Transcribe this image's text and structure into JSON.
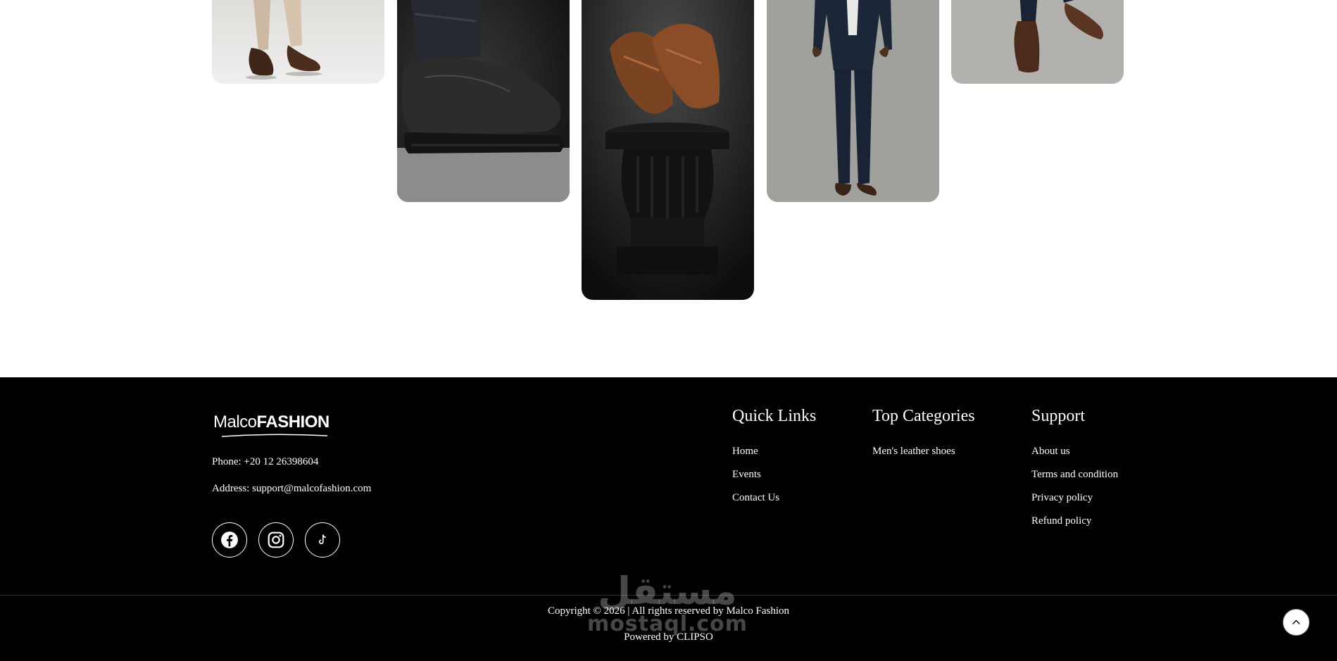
{
  "gallery": {
    "images": [
      {
        "alt": "model-beige-trousers-brown-loafers"
      },
      {
        "alt": "black-leather-shoe-closeup"
      },
      {
        "alt": "brown-croc-leather-shoes-on-pedestal"
      },
      {
        "alt": "model-navy-suit-brown-shoes"
      },
      {
        "alt": "model-navy-suit-brown-brogues"
      }
    ]
  },
  "footer": {
    "brand": {
      "light": "Malco",
      "bold": "FASHION"
    },
    "phone": "Phone: +20 12 26398604",
    "address": "Address: support@malcofashion.com",
    "social": [
      {
        "icon": "facebook-icon"
      },
      {
        "icon": "instagram-icon"
      },
      {
        "icon": "tiktok-icon"
      }
    ],
    "quick_links": {
      "title": "Quick Links",
      "items": [
        "Home",
        "Events",
        "Contact Us"
      ]
    },
    "top_categories": {
      "title": "Top Categories",
      "items": [
        "Men's leather shoes"
      ]
    },
    "support": {
      "title": "Support",
      "items": [
        "About us",
        "Terms and condition",
        "Privacy policy",
        "Refund policy"
      ]
    },
    "copyright": "Copyright © 2026 | All rights reserved by Malco Fashion",
    "powered_by": "Powered by CLIPSO",
    "watermark": {
      "arabic": "مستقل",
      "latin": "mostaql.com"
    }
  },
  "colors": {
    "footer_bg": "#000000",
    "page_bg": "#ffffff",
    "text": "#ffffff"
  }
}
